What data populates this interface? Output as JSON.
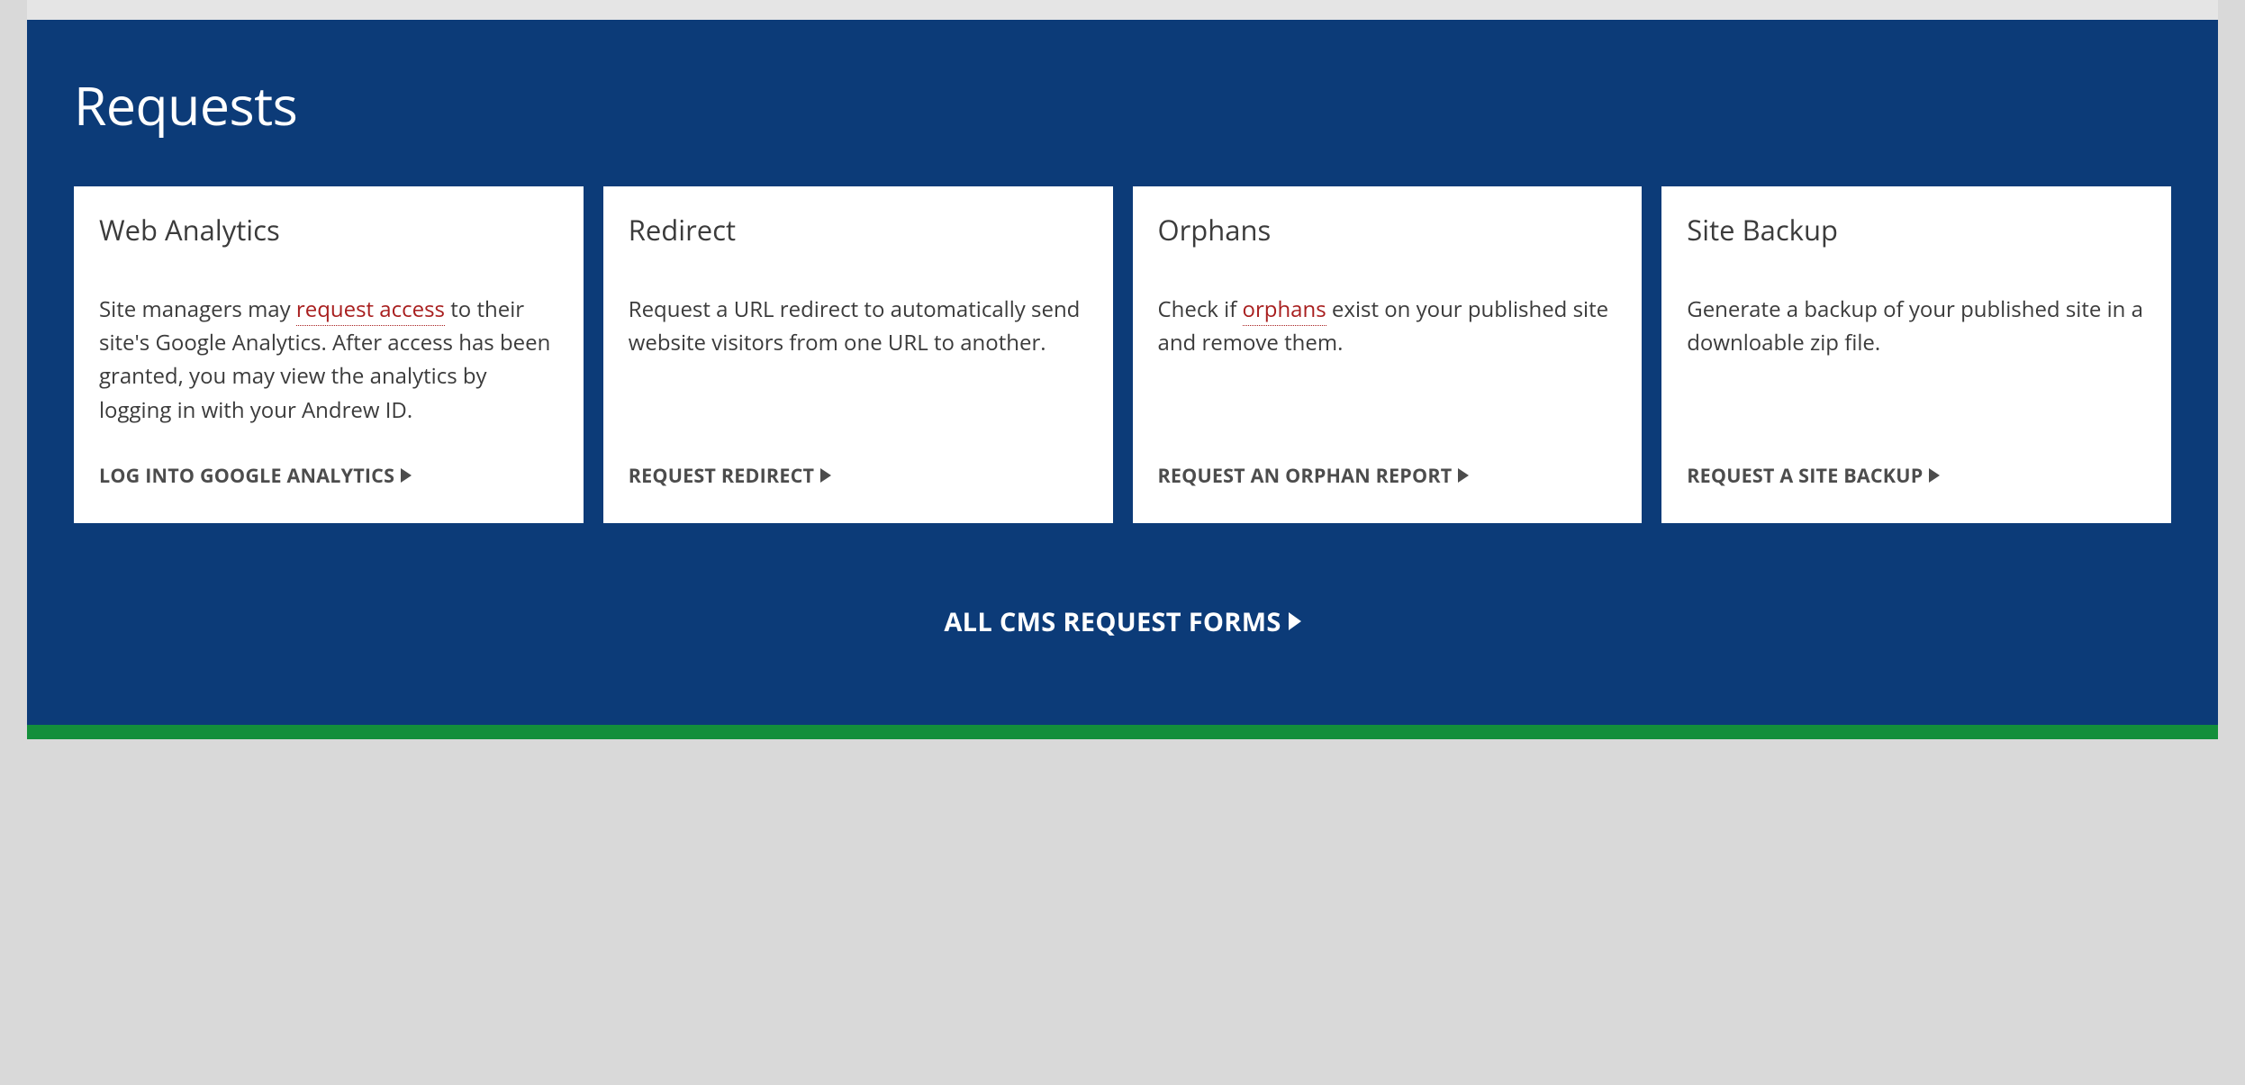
{
  "section": {
    "title": "Requests"
  },
  "cards": [
    {
      "title": "Web Analytics",
      "body_pre": "Site managers may ",
      "link_text": "request access",
      "body_post": " to their site's Google Analytics. After access has been granted, you may view the analytics by logging in with your Andrew ID.",
      "action": "LOG INTO GOOGLE ANALYTICS"
    },
    {
      "title": "Redirect",
      "body_pre": "Request a URL redirect to automatically send website visitors from one URL to another.",
      "link_text": "",
      "body_post": "",
      "action": "REQUEST REDIRECT"
    },
    {
      "title": "Orphans",
      "body_pre": "Check if ",
      "link_text": "orphans",
      "body_post": " exist on your published site and remove them.",
      "action": "REQUEST AN ORPHAN REPORT"
    },
    {
      "title": "Site Backup",
      "body_pre": "Generate a backup of your published site in a downloable zip file.",
      "link_text": "",
      "body_post": "",
      "action": "REQUEST A SITE BACKUP"
    }
  ],
  "footer": {
    "link": "ALL CMS REQUEST FORMS"
  }
}
